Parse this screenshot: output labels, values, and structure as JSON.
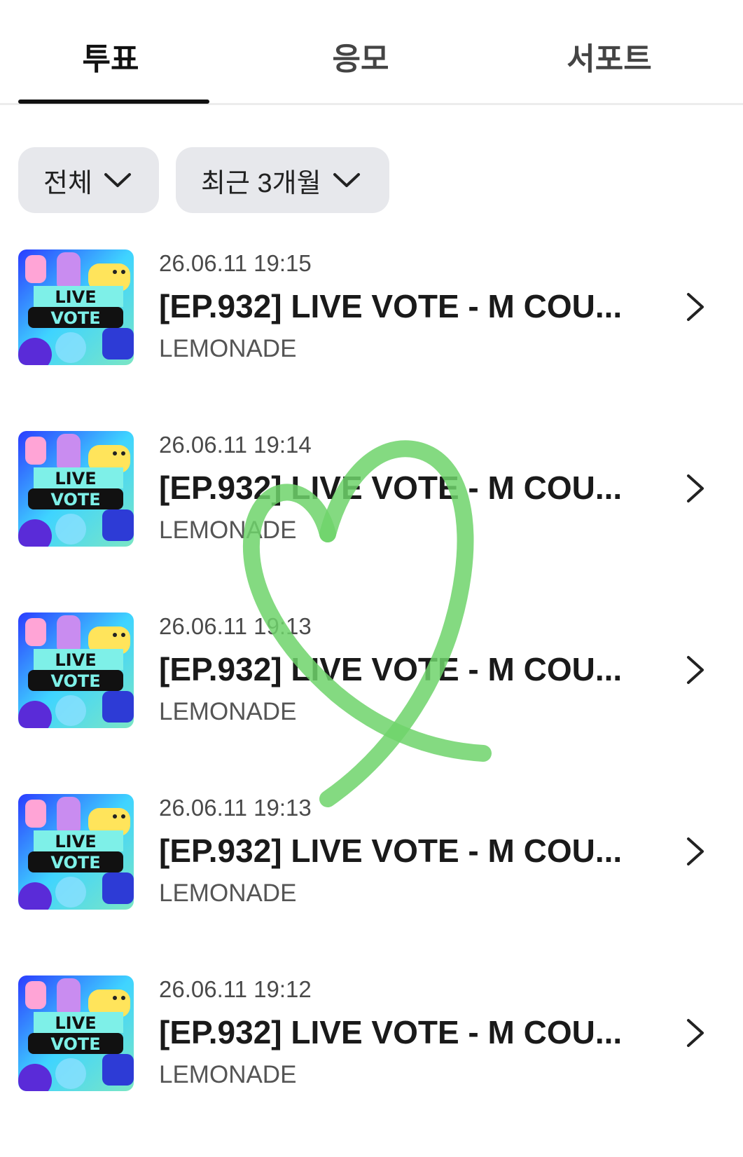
{
  "tabs": [
    {
      "label": "투표",
      "active": true
    },
    {
      "label": "응모",
      "active": false
    },
    {
      "label": "서포트",
      "active": false
    }
  ],
  "filters": {
    "category": "전체",
    "period": "최근 3개월"
  },
  "items": [
    {
      "date": "26.06.11 19:15",
      "title": "[EP.932] LIVE VOTE - M COU...",
      "artist": "LEMONADE",
      "thumb_text": [
        "LIVE",
        "VOTE"
      ]
    },
    {
      "date": "26.06.11 19:14",
      "title": "[EP.932] LIVE VOTE - M COU...",
      "artist": "LEMONADE",
      "thumb_text": [
        "LIVE",
        "VOTE"
      ]
    },
    {
      "date": "26.06.11 19:13",
      "title": "[EP.932] LIVE VOTE - M COU...",
      "artist": "LEMONADE",
      "thumb_text": [
        "LIVE",
        "VOTE"
      ]
    },
    {
      "date": "26.06.11 19:13",
      "title": "[EP.932] LIVE VOTE - M COU...",
      "artist": "LEMONADE",
      "thumb_text": [
        "LIVE",
        "VOTE"
      ]
    },
    {
      "date": "26.06.11 19:12",
      "title": "[EP.932] LIVE VOTE - M COU...",
      "artist": "LEMONADE",
      "thumb_text": [
        "LIVE",
        "VOTE"
      ]
    }
  ],
  "icons": {
    "dropdown": "chevron-down-icon",
    "row_action": "chevron-right-icon",
    "overlay": "heart-drawing"
  },
  "colors": {
    "active_tab_underline": "#111111",
    "chip_background": "#e7e8ec",
    "heart_stroke": "#6fd46b"
  }
}
